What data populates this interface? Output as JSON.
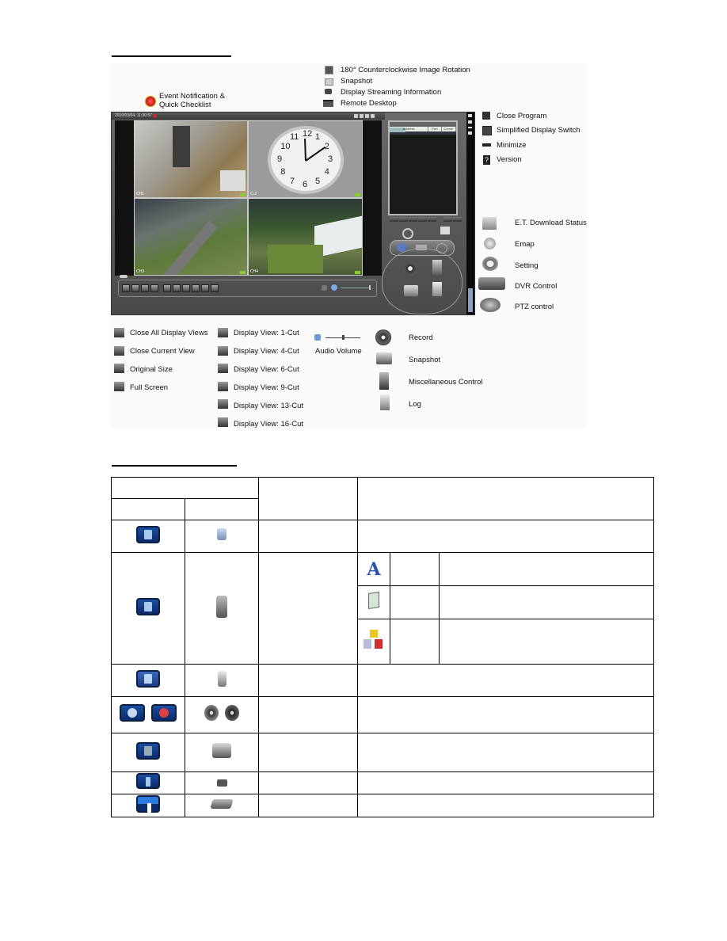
{
  "page": {
    "section1_heading": "",
    "section2_heading": ""
  },
  "annotations": {
    "event_notification": "Event Notification &",
    "quick_checklist": "Quick Checklist",
    "top_right": [
      {
        "icon": "rotate-180-icon",
        "label": "180° Counterclockwise Image Rotation"
      },
      {
        "icon": "snapshot-small-icon",
        "label": "Snapshot"
      },
      {
        "icon": "streaming-info-icon",
        "label": "Display Streaming Information"
      },
      {
        "icon": "remote-desktop-icon",
        "label": "Remote Desktop"
      }
    ],
    "window_controls": [
      {
        "icon": "close-program-icon",
        "label": "Close Program"
      },
      {
        "icon": "simplified-display-icon",
        "label": "Simplified Display Switch"
      },
      {
        "icon": "minimize-icon",
        "label": "Minimize"
      },
      {
        "icon": "version-icon",
        "label": "Version"
      }
    ],
    "side_functions": [
      {
        "icon": "download-status-icon",
        "label": "E.T. Download Status"
      },
      {
        "icon": "emap-icon",
        "label": "Emap"
      },
      {
        "icon": "setting-icon",
        "label": "Setting"
      },
      {
        "icon": "dvr-control-icon",
        "label": "DVR Control"
      },
      {
        "icon": "ptz-control-icon",
        "label": "PTZ control"
      }
    ],
    "view_controls": [
      {
        "icon": "close-all-views-icon",
        "label": "Close All Display Views"
      },
      {
        "icon": "close-current-view-icon",
        "label": "Close Current View"
      },
      {
        "icon": "original-size-icon",
        "label": "Original Size"
      },
      {
        "icon": "full-screen-icon",
        "label": "Full Screen"
      }
    ],
    "display_views": [
      {
        "icon": "view-1-cut-icon",
        "label": "Display View: 1-Cut"
      },
      {
        "icon": "view-4-cut-icon",
        "label": "Display View: 4-Cut"
      },
      {
        "icon": "view-6-cut-icon",
        "label": "Display View: 6-Cut"
      },
      {
        "icon": "view-9-cut-icon",
        "label": "Display View: 9-Cut"
      },
      {
        "icon": "view-13-cut-icon",
        "label": "Display View: 13-Cut"
      },
      {
        "icon": "view-16-cut-icon",
        "label": "Display View: 16-Cut"
      }
    ],
    "audio_volume": "Audio Volume",
    "main_functions": [
      {
        "icon": "record-icon",
        "label": "Record"
      },
      {
        "icon": "snapshot-icon",
        "label": "Snapshot"
      },
      {
        "icon": "misc-control-icon",
        "label": "Miscellaneous Control"
      },
      {
        "icon": "log-icon",
        "label": "Log"
      }
    ]
  },
  "app": {
    "timestamp": "2010/03/04, 11:30:57",
    "cameras": [
      {
        "label": "CH1"
      },
      {
        "label": "C-2"
      },
      {
        "label": "CH3"
      },
      {
        "label": "CH4"
      }
    ],
    "list_headers": [
      "Address",
      "Port",
      "Comm"
    ],
    "clock_numbers": [
      "12",
      "1",
      "2",
      "3",
      "4",
      "5",
      "6",
      "7",
      "8",
      "9",
      "10",
      "11"
    ]
  },
  "table": {
    "rows": [
      {
        "old_icon": "info-book-icon",
        "new_icon": "log-doc-icon"
      },
      {
        "old_icon": "copy-pages-icon",
        "new_icon": "misc-control-icon",
        "sub": [
          "font-a-icon",
          "picture-icon",
          "blocks-icon"
        ]
      },
      {
        "old_icon": "notes-icon",
        "new_icon": "log-icon"
      },
      {
        "old_icon": "record-blue-icon",
        "old_icon2": "record-blue-active-icon",
        "new_icon": "record-icon",
        "new_icon2": "record-active-icon"
      },
      {
        "old_icon": "snapshot-blue-icon",
        "new_icon": "snapshot-icon"
      },
      {
        "old_icon": "streaming-blue-icon",
        "new_icon": "streaming-info-icon"
      },
      {
        "old_icon": "remote-blue-icon",
        "new_icon": "dvr-control-icon"
      }
    ]
  }
}
